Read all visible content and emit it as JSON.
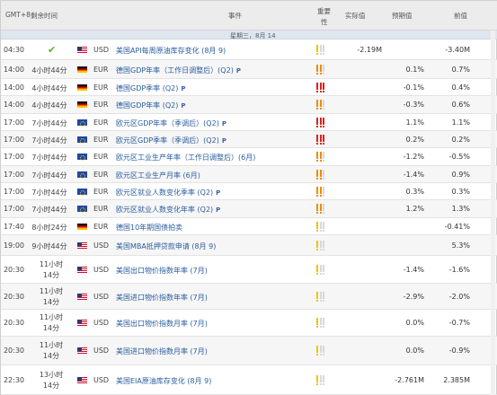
{
  "header": {
    "gmt": "GMT+8",
    "remaining": "剩余时间",
    "event": "事件",
    "importance_line1": "重要",
    "importance_line2": "性",
    "actual": "实际值",
    "forecast": "预期值",
    "previous": "前值"
  },
  "date_band": "星期三，8月 14",
  "colors": {
    "level1": "#f2c200",
    "level2": "#f08a00",
    "level3": "#d92020",
    "event_link": "#2a5d9f",
    "released_check": "#5bb02b"
  },
  "rows": [
    {
      "time": "04:30",
      "remaining": "",
      "released": true,
      "flag": "us-flag-icon",
      "currency": "USD",
      "event": "美国API每周原油库存变化 (8月 9)",
      "p_badge": "",
      "importance": 1,
      "actual": "-2.19M",
      "forecast": "",
      "previous": "-3.40M"
    },
    {
      "time": "14:00",
      "remaining": "4小时44分",
      "released": false,
      "flag": "de-flag-icon",
      "currency": "EUR",
      "event": "德国GDP年率（工作日调整后）(Q2)",
      "p_badge": "P",
      "importance": 2,
      "actual": "",
      "forecast": "0.1%",
      "previous": "0.7%"
    },
    {
      "time": "14:00",
      "remaining": "4小时44分",
      "released": false,
      "flag": "de-flag-icon",
      "currency": "EUR",
      "event": "德国GDP季率 (Q2)",
      "p_badge": "P",
      "importance": 3,
      "actual": "",
      "forecast": "-0.1%",
      "previous": "0.4%"
    },
    {
      "time": "14:00",
      "remaining": "4小时44分",
      "released": false,
      "flag": "de-flag-icon",
      "currency": "EUR",
      "event": "德国GDP年率 (Q2)",
      "p_badge": "P",
      "importance": 2,
      "actual": "",
      "forecast": "-0.3%",
      "previous": "0.6%"
    },
    {
      "time": "17:00",
      "remaining": "7小时44分",
      "released": false,
      "flag": "eu-flag-icon",
      "currency": "EUR",
      "event": "欧元区GDP年率（季调后）(Q2)",
      "p_badge": "P",
      "importance": 3,
      "actual": "",
      "forecast": "1.1%",
      "previous": "1.1%"
    },
    {
      "time": "17:00",
      "remaining": "7小时44分",
      "released": false,
      "flag": "eu-flag-icon",
      "currency": "EUR",
      "event": "欧元区GDP季率（季调后）(Q2)",
      "p_badge": "P",
      "importance": 3,
      "actual": "",
      "forecast": "0.2%",
      "previous": "0.2%"
    },
    {
      "time": "17:00",
      "remaining": "7小时44分",
      "released": false,
      "flag": "eu-flag-icon",
      "currency": "EUR",
      "event": "欧元区工业生产年率（工作日调整后）(6月)",
      "p_badge": "",
      "importance": 2,
      "actual": "",
      "forecast": "-1.2%",
      "previous": "-0.5%"
    },
    {
      "time": "17:00",
      "remaining": "7小时44分",
      "released": false,
      "flag": "eu-flag-icon",
      "currency": "EUR",
      "event": "欧元区工业生产月率 (6月)",
      "p_badge": "",
      "importance": 2,
      "actual": "",
      "forecast": "-1.4%",
      "previous": "0.9%"
    },
    {
      "time": "17:00",
      "remaining": "7小时44分",
      "released": false,
      "flag": "eu-flag-icon",
      "currency": "EUR",
      "event": "欧元区就业人数变化季率 (Q2)",
      "p_badge": "P",
      "importance": 2,
      "actual": "",
      "forecast": "0.3%",
      "previous": "0.3%"
    },
    {
      "time": "17:00",
      "remaining": "7小时44分",
      "released": false,
      "flag": "eu-flag-icon",
      "currency": "EUR",
      "event": "欧元区就业人数变化年率 (Q2)",
      "p_badge": "P",
      "importance": 2,
      "actual": "",
      "forecast": "1.2%",
      "previous": "1.3%"
    },
    {
      "time": "17:40",
      "remaining": "8小时24分",
      "released": false,
      "flag": "de-flag-icon",
      "currency": "EUR",
      "event": "德国10年期国债拍卖",
      "p_badge": "",
      "importance": 1,
      "actual": "",
      "forecast": "",
      "previous": "-0.41%"
    },
    {
      "time": "19:00",
      "remaining": "9小时44分",
      "released": false,
      "flag": "us-flag-icon",
      "currency": "USD",
      "event": "美国MBA抵押贷款申请 (8月 9)",
      "p_badge": "",
      "importance": 1,
      "actual": "",
      "forecast": "",
      "previous": "5.3%"
    },
    {
      "time": "20:30",
      "remaining": "11小时14分",
      "released": false,
      "flag": "us-flag-icon",
      "currency": "USD",
      "event": "美国出口物价指数年率 (7月)",
      "p_badge": "",
      "importance": 1,
      "actual": "",
      "forecast": "-1.4%",
      "previous": "-1.6%"
    },
    {
      "time": "20:30",
      "remaining": "11小时14分",
      "released": false,
      "flag": "us-flag-icon",
      "currency": "USD",
      "event": "美国进口物价指数年率 (7月)",
      "p_badge": "",
      "importance": 1,
      "actual": "",
      "forecast": "-2.9%",
      "previous": "-2.0%"
    },
    {
      "time": "20:30",
      "remaining": "11小时14分",
      "released": false,
      "flag": "us-flag-icon",
      "currency": "USD",
      "event": "美国出口物价指数月率 (7月)",
      "p_badge": "",
      "importance": 1,
      "actual": "",
      "forecast": "0.0%",
      "previous": "-0.7%"
    },
    {
      "time": "20:30",
      "remaining": "11小时14分",
      "released": false,
      "flag": "us-flag-icon",
      "currency": "USD",
      "event": "美国进口物价指数月率 (7月)",
      "p_badge": "",
      "importance": 1,
      "actual": "",
      "forecast": "0.0%",
      "previous": "-0.9%"
    },
    {
      "time": "22:30",
      "remaining": "13小时14分",
      "released": false,
      "flag": "us-flag-icon",
      "currency": "USD",
      "event": "美国EIA原油库存变化 (8月 9)",
      "p_badge": "",
      "importance": 1,
      "actual": "",
      "forecast": "-2.761M",
      "previous": "2.385M"
    }
  ]
}
